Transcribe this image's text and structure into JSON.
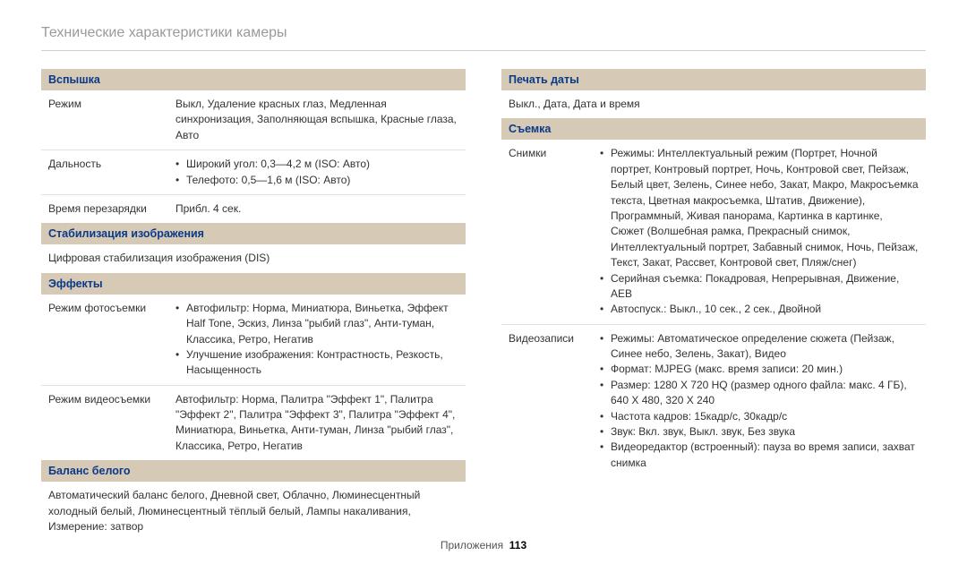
{
  "pageTitle": "Технические характеристики камеры",
  "footer": {
    "label": "Приложения",
    "page": "113"
  },
  "left": {
    "flash": {
      "header": "Вспышка",
      "rows": [
        {
          "label": "Режим",
          "value": "Выкл, Удаление красных глаз, Медленная синхронизация, Заполняющая вспышка, Красные глаза, Авто"
        },
        {
          "label": "Дальность",
          "bullets": [
            "Широкий угол: 0,3—4,2 м (ISO: Авто)",
            "Телефото: 0,5—1,6 м (ISO: Авто)"
          ]
        },
        {
          "label": "Время перезарядки",
          "value": "Прибл. 4 сек."
        }
      ]
    },
    "stabilization": {
      "header": "Стабилизация изображения",
      "text": "Цифровая стабилизация изображения (DIS)"
    },
    "effects": {
      "header": "Эффекты",
      "rows": [
        {
          "label": "Режим фотосъемки",
          "bullets": [
            "Автофильтр: Норма, Миниатюра, Виньетка, Эффект Half Tone, Эскиз, Линза \"рыбий глаз\", Анти-туман, Классика, Ретро, Негатив",
            "Улучшение изображения: Контрастность, Резкость, Насыщенность"
          ]
        },
        {
          "label": "Режим видеосъемки",
          "value": "Автофильтр: Норма, Палитра \"Эффект 1\", Палитра \"Эффект 2\", Палитра \"Эффект 3\", Палитра \"Эффект 4\", Миниатюра, Виньетка, Анти-туман, Линза \"рыбий глаз\", Классика, Ретро, Негатив"
        }
      ]
    },
    "whitebalance": {
      "header": "Баланс белого",
      "text": "Автоматический баланс белого, Дневной свет, Облачно, Люминесцентный холодный белый, Люминесцентный тёплый белый, Лампы накаливания, Измерение: затвор"
    }
  },
  "right": {
    "dateprint": {
      "header": "Печать даты",
      "text": "Выкл., Дата, Дата и время"
    },
    "shooting": {
      "header": "Съемка",
      "rows": [
        {
          "label": "Снимки",
          "bullets": [
            "Режимы: Интеллектуальный режим (Портрет, Ночной портрет, Контровый портрет, Ночь, Контровой свет, Пейзаж, Белый цвет, Зелень, Синее небо, Закат, Макро, Макросъемка текста, Цветная макросъемка, Штатив, Движение), Программный, Живая панорама, Картинка в картинке, Сюжет (Волшебная рамка, Прекрасный снимок, Интеллектуальный портрет, Забавный снимок, Ночь, Пейзаж, Текст, Закат, Рассвет, Контровой свет, Пляж/снег)",
            "Серийная съемка: Покадровая, Непрерывная, Движение, AEB",
            "Автоспуск.: Выкл., 10 сек., 2 сек., Двойной"
          ]
        },
        {
          "label": "Видеозаписи",
          "bullets": [
            "Режимы: Автоматическое определение сюжета (Пейзаж, Синее небо, Зелень, Закат), Видео",
            "Формат: MJPEG (макс. время записи: 20 мин.)",
            "Размер: 1280 X 720 HQ (размер одного файла: макс. 4 ГБ), 640 X 480, 320 X 240",
            "Частота кадров: 15кадр/с, 30кадр/с",
            "Звук: Вкл. звук, Выкл. звук, Без звука",
            "Видеоредактор (встроенный): пауза во время записи, захват снимка"
          ]
        }
      ]
    }
  }
}
